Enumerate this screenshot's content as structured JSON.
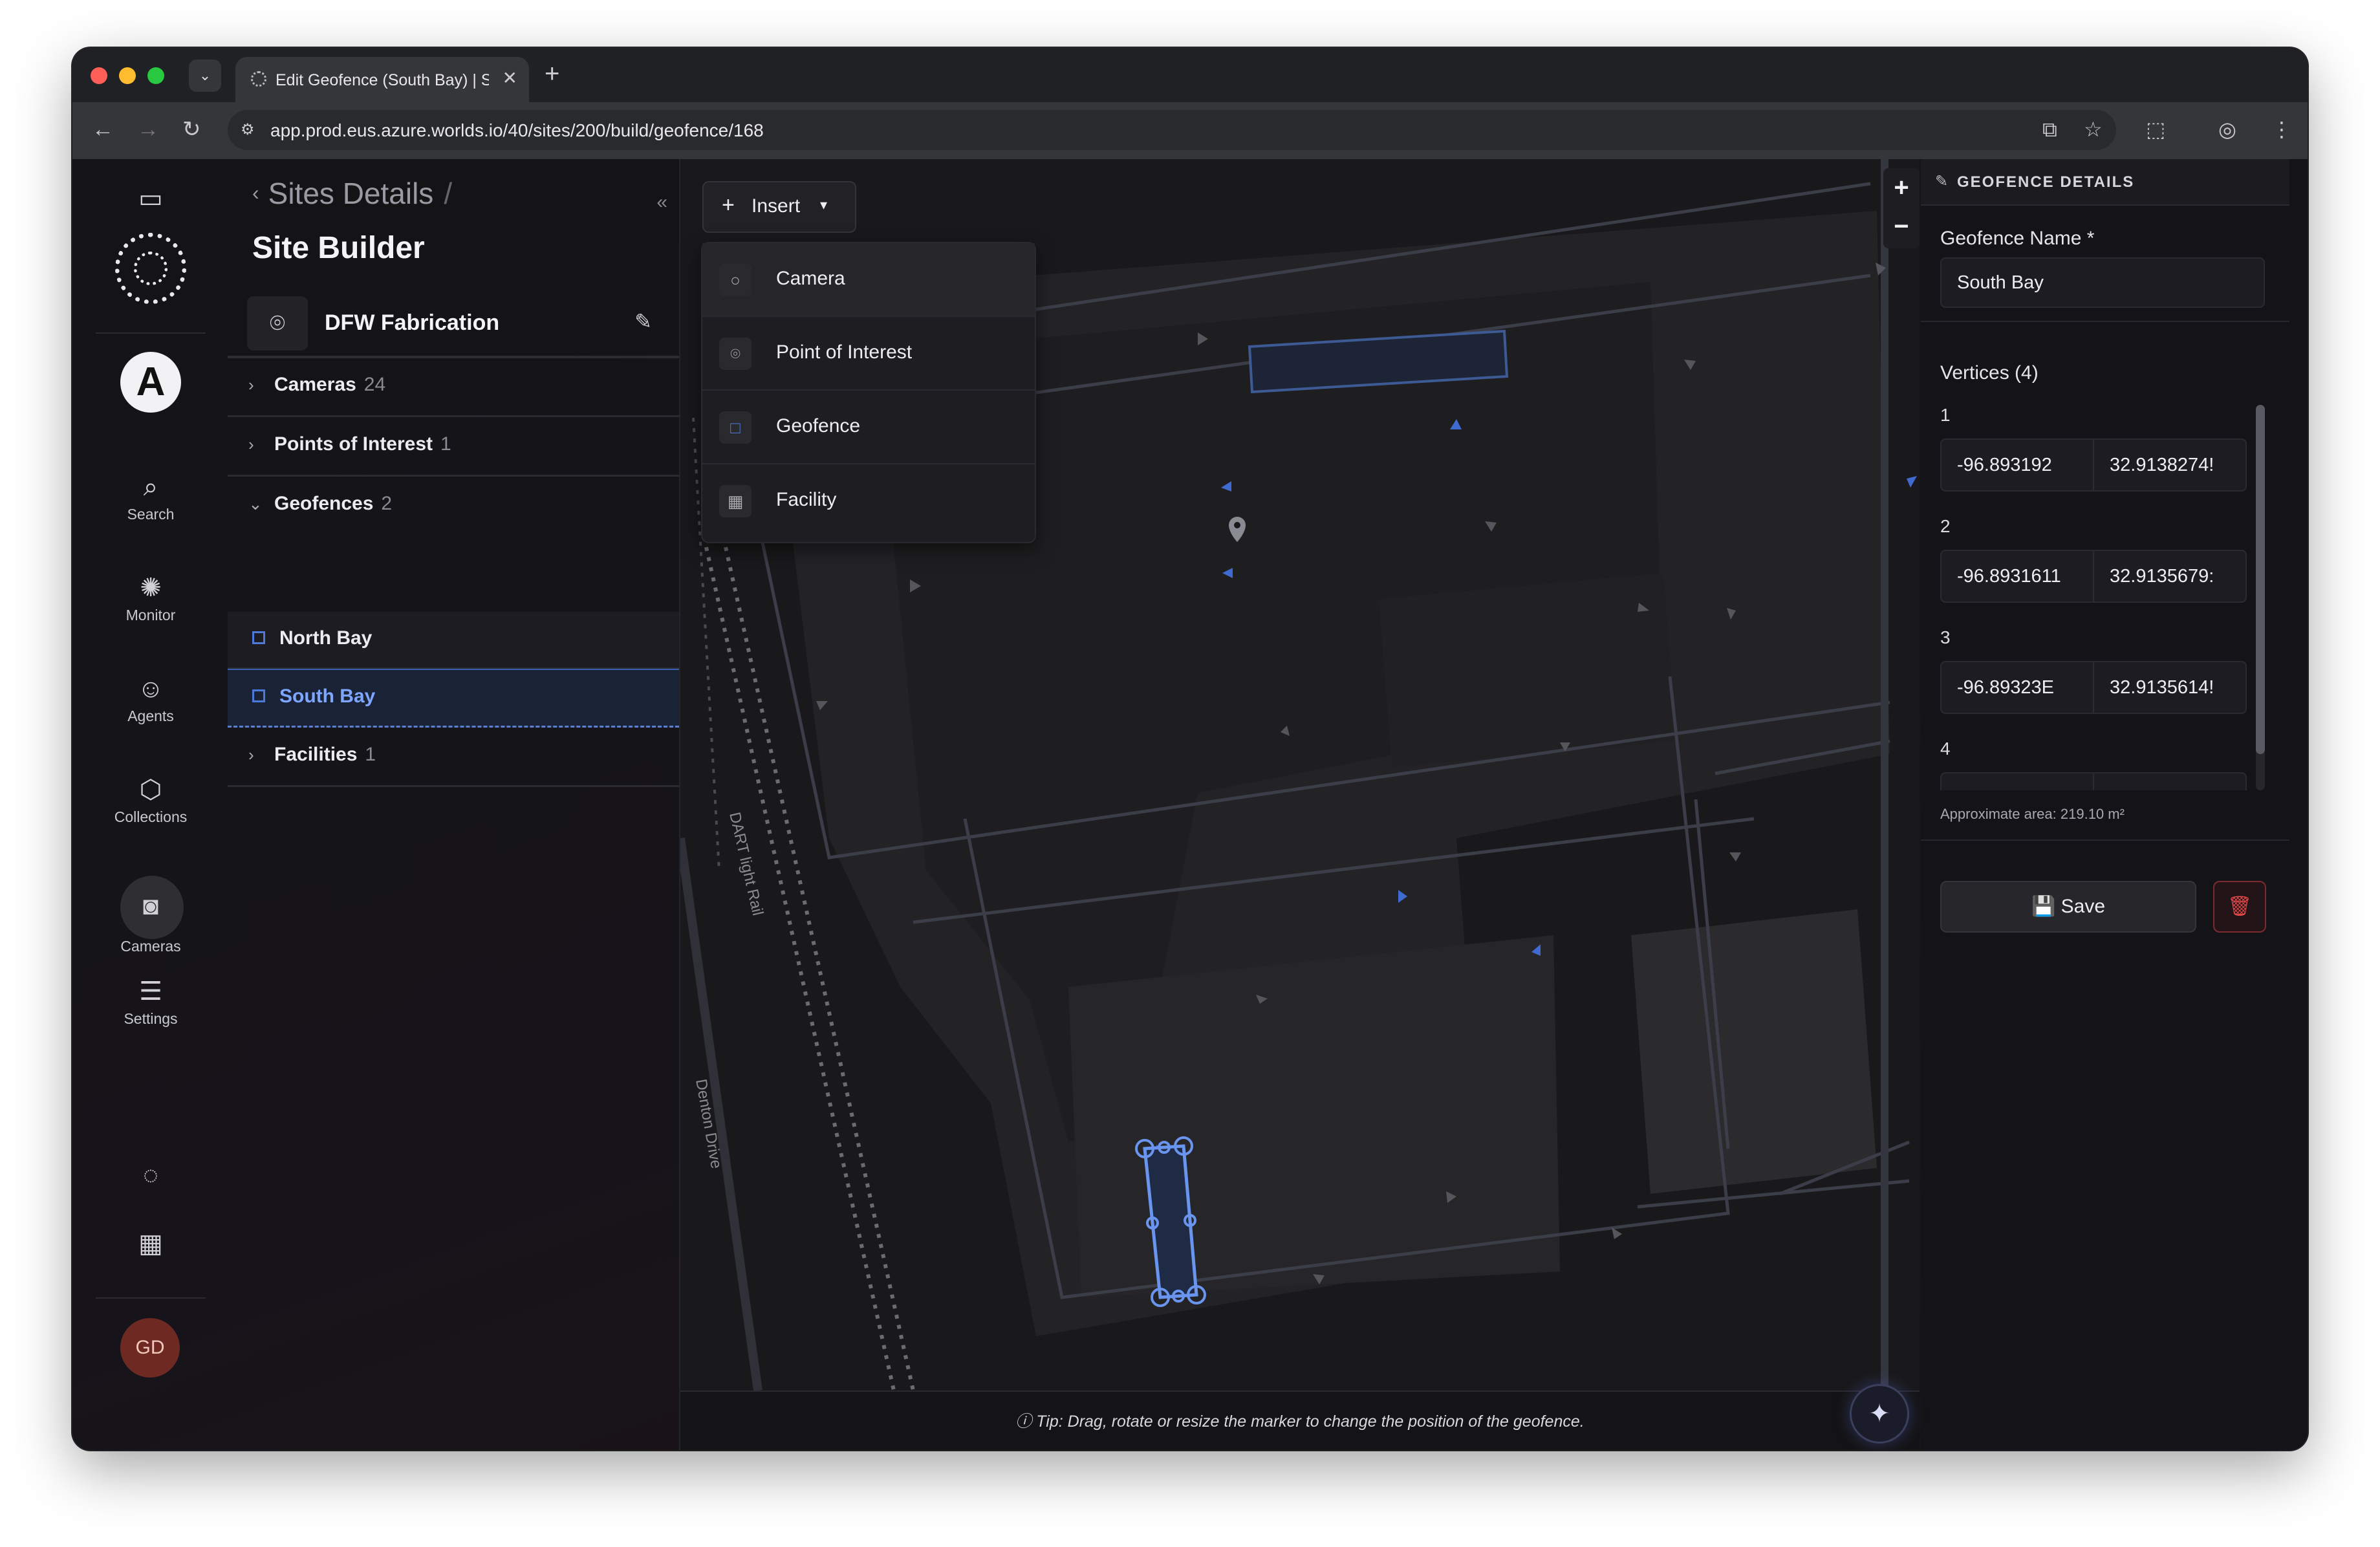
{
  "browser": {
    "tab_title": "Edit Geofence (South Bay) | S",
    "url": "app.prod.eus.azure.worlds.io/40/sites/200/build/geofence/168"
  },
  "rail": {
    "org_initial": "A",
    "items": [
      {
        "label": "Search",
        "icon": "search-icon"
      },
      {
        "label": "Monitor",
        "icon": "monitor-icon"
      },
      {
        "label": "Agents",
        "icon": "agents-icon"
      },
      {
        "label": "Collections",
        "icon": "collections-icon"
      },
      {
        "label": "Cameras",
        "icon": "camera-icon"
      },
      {
        "label": "Settings",
        "icon": "settings-icon"
      }
    ],
    "avatar_initials": "GD"
  },
  "panel": {
    "breadcrumb": "Sites Details",
    "title": "Site Builder",
    "site_name": "DFW Fabrication",
    "sections": {
      "cameras": {
        "label": "Cameras",
        "count": "24"
      },
      "poi": {
        "label": "Points of Interest",
        "count": "1"
      },
      "geofences": {
        "label": "Geofences",
        "count": "2"
      },
      "facilities": {
        "label": "Facilities",
        "count": "1"
      }
    },
    "geofences": [
      "North Bay",
      "South Bay"
    ]
  },
  "map": {
    "insert_label": "Insert",
    "menu": [
      "Camera",
      "Point of Interest",
      "Geofence",
      "Facility"
    ],
    "street_labels": [
      "DART light Rail",
      "Denton Drive"
    ],
    "tip": "Tip: Drag, rotate or resize the marker to change the position of the geofence."
  },
  "details": {
    "header": "GEOFENCE DETAILS",
    "name_label": "Geofence Name *",
    "name_value": "South Bay",
    "vertices_label": "Vertices (4)",
    "vertices": [
      {
        "n": "1",
        "lon": "-96.893192",
        "lat": "32.9138274!"
      },
      {
        "n": "2",
        "lon": "-96.8931611",
        "lat": "32.9135679:"
      },
      {
        "n": "3",
        "lon": "-96.89323E",
        "lat": "32.9135614!"
      },
      {
        "n": "4",
        "lon": "",
        "lat": ""
      }
    ],
    "area": "Approximate area: 219.10 m²",
    "save_label": "Save"
  }
}
